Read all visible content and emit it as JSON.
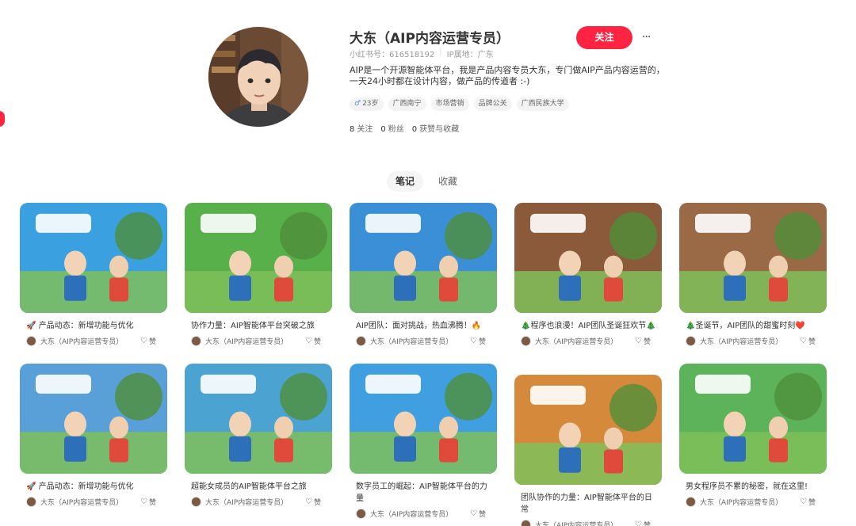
{
  "profile": {
    "name": "大东（AIP内容运营专员）",
    "id_label": "小红书号：616518192",
    "ip_label": "IP属地：广东",
    "follow_label": "关注",
    "more_label": "···",
    "bio": "AIP是一个开源智能体平台，我是产品内容专员大东，专门做AIP产品内容运营的，一天24小时都在设计内容，做产品的传道者 :-)",
    "tags": [
      "23岁",
      "广西南宁",
      "市场营销",
      "品牌公关",
      "广西民族大学"
    ],
    "stats": [
      {
        "count": "8",
        "label": "关注"
      },
      {
        "count": "0",
        "label": "粉丝"
      },
      {
        "count": "0",
        "label": "获赞与收藏"
      }
    ]
  },
  "tabs": [
    {
      "label": "笔记",
      "active": true
    },
    {
      "label": "收藏",
      "active": false
    }
  ],
  "notes": [
    {
      "title": "🚀 产品动态：新增功能与优化",
      "author": "大东（AIP内容运营专员）",
      "like_label": "赞",
      "theme": "#3aa0e0"
    },
    {
      "title": "协作力量：AIP智能体平台突破之旅",
      "author": "大东（AIP内容运营专员）",
      "like_label": "赞",
      "theme": "#58b04a"
    },
    {
      "title": "AIP团队：面对挑战，热血沸腾！🔥",
      "author": "大东（AIP内容运营专员）",
      "like_label": "赞",
      "theme": "#3b8fd6"
    },
    {
      "title": "🎄程序也浪漫！AIP团队圣诞狂欢节🎄",
      "author": "大东（AIP内容运营专员）",
      "like_label": "赞",
      "theme": "#8a5a3a"
    },
    {
      "title": "🎄圣诞节，AIP团队的甜蜜时刻❤️",
      "author": "大东（AIP内容运营专员）",
      "like_label": "赞",
      "theme": "#9a6a46"
    },
    {
      "title": "🚀 产品动态：新增功能与优化",
      "author": "大东（AIP内容运营专员）",
      "like_label": "赞",
      "theme": "#5aa0d8"
    },
    {
      "title": "超能女成员的AIP智能体平台之旅",
      "author": "大东（AIP内容运营专员）",
      "like_label": "赞",
      "theme": "#4aa3d0"
    },
    {
      "title": "数字员工的崛起：AIP智能体平台的力量",
      "author": "大东（AIP内容运营专员）",
      "like_label": "赞",
      "theme": "#3f9fe0"
    },
    {
      "title": "团队协作的力量：AIP智能体平台的日常",
      "author": "大东（AIP内容运营专员）",
      "like_label": "赞",
      "theme": "#d48a3a"
    },
    {
      "title": "男女程序员不累的秘密，就在这里!",
      "author": "大东（AIP内容运营专员）",
      "like_label": "赞",
      "theme": "#5cb35a"
    }
  ],
  "icons": {
    "more": "more-dots-icon",
    "age": "gender-age-icon",
    "like": "heart-icon"
  },
  "colors": {
    "accent": "#ff2442"
  }
}
